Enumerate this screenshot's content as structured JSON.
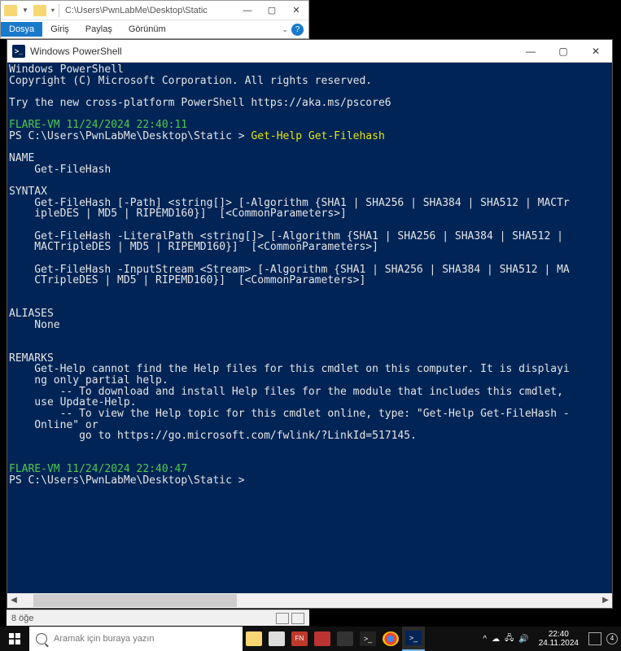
{
  "explorer": {
    "path": "C:\\Users\\PwnLabMe\\Desktop\\Static",
    "menu": {
      "dosya": "Dosya",
      "giris": "Giriş",
      "paylas": "Paylaş",
      "gorunum": "Görünüm"
    }
  },
  "powershell": {
    "title": "Windows PowerShell",
    "lines": {
      "l1": "Windows PowerShell",
      "l2": "Copyright (C) Microsoft Corporation. All rights reserved.",
      "l3": "Try the new cross-platform PowerShell https://aka.ms/pscore6",
      "ts1": "FLARE-VM 11/24/2024 22:40:11",
      "prompt1a": "PS C:\\Users\\PwnLabMe\\Desktop\\Static > ",
      "cmd1": "Get-Help Get-Filehash",
      "name_h": "NAME",
      "name_v": "    Get-FileHash",
      "syntax_h": "SYNTAX",
      "syn1": "    Get-FileHash [-Path] <string[]> [-Algorithm {SHA1 | SHA256 | SHA384 | SHA512 | MACTr",
      "syn1b": "    ipleDES | MD5 | RIPEMD160}]  [<CommonParameters>]",
      "syn2": "    Get-FileHash -LiteralPath <string[]> [-Algorithm {SHA1 | SHA256 | SHA384 | SHA512 |",
      "syn2b": "    MACTripleDES | MD5 | RIPEMD160}]  [<CommonParameters>]",
      "syn3": "    Get-FileHash -InputStream <Stream> [-Algorithm {SHA1 | SHA256 | SHA384 | SHA512 | MA",
      "syn3b": "    CTripleDES | MD5 | RIPEMD160}]  [<CommonParameters>]",
      "alias_h": "ALIASES",
      "alias_v": "    None",
      "rem_h": "REMARKS",
      "rem1": "    Get-Help cannot find the Help files for this cmdlet on this computer. It is displayi",
      "rem1b": "    ng only partial help.",
      "rem2": "        -- To download and install Help files for the module that includes this cmdlet,",
      "rem2b": "    use Update-Help.",
      "rem3": "        -- To view the Help topic for this cmdlet online, type: \"Get-Help Get-FileHash -",
      "rem3b": "    Online\" or",
      "rem4": "           go to https://go.microsoft.com/fwlink/?LinkId=517145.",
      "ts2": "FLARE-VM 11/24/2024 22:40:47",
      "prompt2": "PS C:\\Users\\PwnLabMe\\Desktop\\Static > "
    }
  },
  "statusbar": {
    "items": "8 öğe"
  },
  "taskbar": {
    "search_placeholder": "Aramak için buraya yazın",
    "time": "22:40",
    "date": "24.11.2024",
    "badge": "4"
  }
}
